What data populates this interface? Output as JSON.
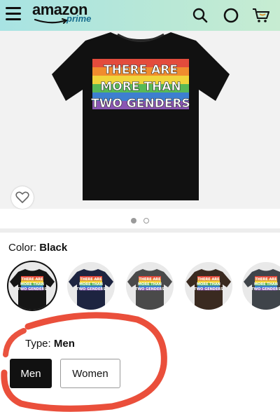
{
  "header": {
    "brand_name": "amazon",
    "brand_sub": "prime",
    "menu_icon": "hamburger-menu-icon",
    "search_icon": "search-icon",
    "alexa_icon": "alexa-icon",
    "cart_icon": "cart-icon"
  },
  "product": {
    "shirt_text": [
      "THERE ARE",
      "MORE THAN",
      "TWO GENDERS"
    ],
    "shirt_color": "#111111",
    "wishlist_icon": "heart-icon",
    "gallery_dots": 2,
    "gallery_active_index": 0
  },
  "color_selector": {
    "label": "Color:",
    "selected_value": "Black",
    "swatches": [
      {
        "color": "#151515",
        "selected": true
      },
      {
        "color": "#1d2440",
        "selected": false
      },
      {
        "color": "#4a4a4a",
        "selected": false
      },
      {
        "color": "#3a2a20",
        "selected": false
      },
      {
        "color": "#3f444a",
        "selected": false
      }
    ],
    "swatch_text": [
      "THERE ARE",
      "MORE THAN",
      "TWO GENDERS"
    ]
  },
  "type_selector": {
    "label": "Type:",
    "selected_value": "Men",
    "options": [
      {
        "label": "Men",
        "selected": true
      },
      {
        "label": "Women",
        "selected": false
      }
    ]
  },
  "colors": {
    "header_start": "#a8e3e3",
    "header_end": "#c7ecd2",
    "annotation_red": "#e8402a",
    "rainbow": [
      "#e34b3c",
      "#f08c2e",
      "#f0d43a",
      "#58b957",
      "#3d7fd0",
      "#8a56b3"
    ]
  }
}
